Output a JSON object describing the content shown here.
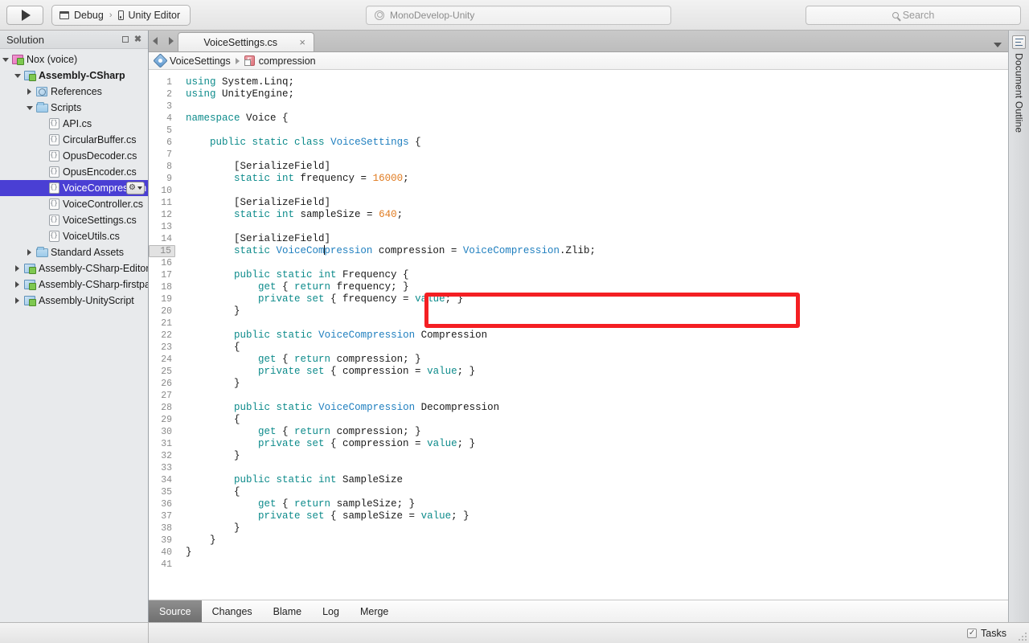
{
  "toolbar": {
    "run_button": "run-button",
    "configuration": "Debug",
    "target": "Unity Editor",
    "separator": "›",
    "status_text": "MonoDevelop-Unity",
    "search_placeholder": "Search"
  },
  "sidebar": {
    "title": "Solution",
    "header_buttons": [
      "minimize",
      "close"
    ],
    "tree": [
      {
        "label": "Nox (voice)",
        "indent": 0,
        "twisty": "down",
        "icon": "solution-icon",
        "bold": false,
        "selected": false
      },
      {
        "label": "Assembly-CSharp",
        "indent": 1,
        "twisty": "down",
        "icon": "project-icon",
        "bold": true,
        "selected": false
      },
      {
        "label": "References",
        "indent": 2,
        "twisty": "right",
        "icon": "references-icon",
        "bold": false,
        "selected": false
      },
      {
        "label": "Scripts",
        "indent": 2,
        "twisty": "down",
        "icon": "folder-icon",
        "bold": false,
        "selected": false
      },
      {
        "label": "API.cs",
        "indent": 3,
        "twisty": "none",
        "icon": "csharp-file-icon",
        "bold": false,
        "selected": false
      },
      {
        "label": "CircularBuffer.cs",
        "indent": 3,
        "twisty": "none",
        "icon": "csharp-file-icon",
        "bold": false,
        "selected": false
      },
      {
        "label": "OpusDecoder.cs",
        "indent": 3,
        "twisty": "none",
        "icon": "csharp-file-icon",
        "bold": false,
        "selected": false
      },
      {
        "label": "OpusEncoder.cs",
        "indent": 3,
        "twisty": "none",
        "icon": "csharp-file-icon",
        "bold": false,
        "selected": false
      },
      {
        "label": "VoiceCompression",
        "indent": 3,
        "twisty": "none",
        "icon": "csharp-file-icon",
        "bold": false,
        "selected": true
      },
      {
        "label": "VoiceController.cs",
        "indent": 3,
        "twisty": "none",
        "icon": "csharp-file-icon",
        "bold": false,
        "selected": false
      },
      {
        "label": "VoiceSettings.cs",
        "indent": 3,
        "twisty": "none",
        "icon": "csharp-file-icon",
        "bold": false,
        "selected": false
      },
      {
        "label": "VoiceUtils.cs",
        "indent": 3,
        "twisty": "none",
        "icon": "csharp-file-icon",
        "bold": false,
        "selected": false
      },
      {
        "label": "Standard Assets",
        "indent": 2,
        "twisty": "right",
        "icon": "folder-icon",
        "bold": false,
        "selected": false
      },
      {
        "label": "Assembly-CSharp-Editor",
        "indent": 1,
        "twisty": "right",
        "icon": "project-icon",
        "bold": false,
        "selected": false
      },
      {
        "label": "Assembly-CSharp-firstpass",
        "indent": 1,
        "twisty": "right",
        "icon": "project-icon",
        "bold": false,
        "selected": false
      },
      {
        "label": "Assembly-UnityScript",
        "indent": 1,
        "twisty": "right",
        "icon": "project-icon",
        "bold": false,
        "selected": false
      }
    ]
  },
  "editor": {
    "tab": {
      "title": "VoiceSettings.cs",
      "close": "×"
    },
    "breadcrumb": {
      "class": "VoiceSettings",
      "member": "compression",
      "separator": "▶"
    },
    "current_line": 15,
    "total_lines": 41,
    "lines": [
      {
        "n": 1,
        "tokens": [
          {
            "t": "kw",
            "s": "using"
          },
          {
            "t": "pl",
            "s": " System.Linq;"
          }
        ]
      },
      {
        "n": 2,
        "tokens": [
          {
            "t": "kw",
            "s": "using"
          },
          {
            "t": "pl",
            "s": " UnityEngine;"
          }
        ]
      },
      {
        "n": 3,
        "tokens": []
      },
      {
        "n": 4,
        "tokens": [
          {
            "t": "kw",
            "s": "namespace"
          },
          {
            "t": "pl",
            "s": " Voice {"
          }
        ]
      },
      {
        "n": 5,
        "tokens": []
      },
      {
        "n": 6,
        "tokens": [
          {
            "t": "pl",
            "s": "    "
          },
          {
            "t": "kw",
            "s": "public static class"
          },
          {
            "t": "pl",
            "s": " "
          },
          {
            "t": "ty",
            "s": "VoiceSettings"
          },
          {
            "t": "pl",
            "s": " {"
          }
        ]
      },
      {
        "n": 7,
        "tokens": []
      },
      {
        "n": 8,
        "tokens": [
          {
            "t": "pl",
            "s": "        [SerializeField]"
          }
        ]
      },
      {
        "n": 9,
        "tokens": [
          {
            "t": "pl",
            "s": "        "
          },
          {
            "t": "kw",
            "s": "static int"
          },
          {
            "t": "pl",
            "s": " frequency = "
          },
          {
            "t": "num",
            "s": "16000"
          },
          {
            "t": "pl",
            "s": ";"
          }
        ]
      },
      {
        "n": 10,
        "tokens": []
      },
      {
        "n": 11,
        "tokens": [
          {
            "t": "pl",
            "s": "        [SerializeField]"
          }
        ]
      },
      {
        "n": 12,
        "tokens": [
          {
            "t": "pl",
            "s": "        "
          },
          {
            "t": "kw",
            "s": "static int"
          },
          {
            "t": "pl",
            "s": " sampleSize = "
          },
          {
            "t": "num",
            "s": "640"
          },
          {
            "t": "pl",
            "s": ";"
          }
        ]
      },
      {
        "n": 13,
        "tokens": []
      },
      {
        "n": 14,
        "tokens": [
          {
            "t": "pl",
            "s": "        [SerializeField]"
          }
        ]
      },
      {
        "n": 15,
        "tokens": [
          {
            "t": "pl",
            "s": "        "
          },
          {
            "t": "kw",
            "s": "static"
          },
          {
            "t": "pl",
            "s": " "
          },
          {
            "t": "ty",
            "s": "VoiceCom"
          },
          {
            "t": "caret",
            "s": ""
          },
          {
            "t": "ty",
            "s": "pression"
          },
          {
            "t": "pl",
            "s": " compression = "
          },
          {
            "t": "ty",
            "s": "VoiceCompression"
          },
          {
            "t": "pl",
            "s": ".Zlib;"
          }
        ]
      },
      {
        "n": 16,
        "tokens": []
      },
      {
        "n": 17,
        "tokens": [
          {
            "t": "pl",
            "s": "        "
          },
          {
            "t": "kw",
            "s": "public static int"
          },
          {
            "t": "pl",
            "s": " Frequency {"
          }
        ]
      },
      {
        "n": 18,
        "tokens": [
          {
            "t": "pl",
            "s": "            "
          },
          {
            "t": "kw",
            "s": "get"
          },
          {
            "t": "pl",
            "s": " { "
          },
          {
            "t": "kw",
            "s": "return"
          },
          {
            "t": "pl",
            "s": " frequency; }"
          }
        ]
      },
      {
        "n": 19,
        "tokens": [
          {
            "t": "pl",
            "s": "            "
          },
          {
            "t": "kw",
            "s": "private set"
          },
          {
            "t": "pl",
            "s": " { frequency = "
          },
          {
            "t": "kw",
            "s": "value"
          },
          {
            "t": "pl",
            "s": "; }"
          }
        ]
      },
      {
        "n": 20,
        "tokens": [
          {
            "t": "pl",
            "s": "        }"
          }
        ]
      },
      {
        "n": 21,
        "tokens": []
      },
      {
        "n": 22,
        "tokens": [
          {
            "t": "pl",
            "s": "        "
          },
          {
            "t": "kw",
            "s": "public static"
          },
          {
            "t": "pl",
            "s": " "
          },
          {
            "t": "ty",
            "s": "VoiceCompression"
          },
          {
            "t": "pl",
            "s": " Compression"
          }
        ]
      },
      {
        "n": 23,
        "tokens": [
          {
            "t": "pl",
            "s": "        {"
          }
        ]
      },
      {
        "n": 24,
        "tokens": [
          {
            "t": "pl",
            "s": "            "
          },
          {
            "t": "kw",
            "s": "get"
          },
          {
            "t": "pl",
            "s": " { "
          },
          {
            "t": "kw",
            "s": "return"
          },
          {
            "t": "pl",
            "s": " compression; }"
          }
        ]
      },
      {
        "n": 25,
        "tokens": [
          {
            "t": "pl",
            "s": "            "
          },
          {
            "t": "kw",
            "s": "private set"
          },
          {
            "t": "pl",
            "s": " { compression = "
          },
          {
            "t": "kw",
            "s": "value"
          },
          {
            "t": "pl",
            "s": "; }"
          }
        ]
      },
      {
        "n": 26,
        "tokens": [
          {
            "t": "pl",
            "s": "        }"
          }
        ]
      },
      {
        "n": 27,
        "tokens": []
      },
      {
        "n": 28,
        "tokens": [
          {
            "t": "pl",
            "s": "        "
          },
          {
            "t": "kw",
            "s": "public static"
          },
          {
            "t": "pl",
            "s": " "
          },
          {
            "t": "ty",
            "s": "VoiceCompression"
          },
          {
            "t": "pl",
            "s": " Decompression"
          }
        ]
      },
      {
        "n": 29,
        "tokens": [
          {
            "t": "pl",
            "s": "        {"
          }
        ]
      },
      {
        "n": 30,
        "tokens": [
          {
            "t": "pl",
            "s": "            "
          },
          {
            "t": "kw",
            "s": "get"
          },
          {
            "t": "pl",
            "s": " { "
          },
          {
            "t": "kw",
            "s": "return"
          },
          {
            "t": "pl",
            "s": " compression; }"
          }
        ]
      },
      {
        "n": 31,
        "tokens": [
          {
            "t": "pl",
            "s": "            "
          },
          {
            "t": "kw",
            "s": "private set"
          },
          {
            "t": "pl",
            "s": " { compression = "
          },
          {
            "t": "kw",
            "s": "value"
          },
          {
            "t": "pl",
            "s": "; }"
          }
        ]
      },
      {
        "n": 32,
        "tokens": [
          {
            "t": "pl",
            "s": "        }"
          }
        ]
      },
      {
        "n": 33,
        "tokens": []
      },
      {
        "n": 34,
        "tokens": [
          {
            "t": "pl",
            "s": "        "
          },
          {
            "t": "kw",
            "s": "public static int"
          },
          {
            "t": "pl",
            "s": " SampleSize"
          }
        ]
      },
      {
        "n": 35,
        "tokens": [
          {
            "t": "pl",
            "s": "        {"
          }
        ]
      },
      {
        "n": 36,
        "tokens": [
          {
            "t": "pl",
            "s": "            "
          },
          {
            "t": "kw",
            "s": "get"
          },
          {
            "t": "pl",
            "s": " { "
          },
          {
            "t": "kw",
            "s": "return"
          },
          {
            "t": "pl",
            "s": " sampleSize; }"
          }
        ]
      },
      {
        "n": 37,
        "tokens": [
          {
            "t": "pl",
            "s": "            "
          },
          {
            "t": "kw",
            "s": "private set"
          },
          {
            "t": "pl",
            "s": " { sampleSize = "
          },
          {
            "t": "kw",
            "s": "value"
          },
          {
            "t": "pl",
            "s": "; }"
          }
        ]
      },
      {
        "n": 38,
        "tokens": [
          {
            "t": "pl",
            "s": "        }"
          }
        ]
      },
      {
        "n": 39,
        "tokens": [
          {
            "t": "pl",
            "s": "    }"
          }
        ]
      },
      {
        "n": 40,
        "tokens": [
          {
            "t": "pl",
            "s": "}"
          }
        ]
      },
      {
        "n": 41,
        "tokens": []
      }
    ],
    "annotation": {
      "shape": "rectangle",
      "color": "#f41f23",
      "covers_lines": [
        14,
        15
      ]
    }
  },
  "view_tabs": [
    {
      "label": "Source",
      "active": true
    },
    {
      "label": "Changes",
      "active": false
    },
    {
      "label": "Blame",
      "active": false
    },
    {
      "label": "Log",
      "active": false
    },
    {
      "label": "Merge",
      "active": false
    }
  ],
  "right_dock": {
    "label": "Document Outline"
  },
  "status_bar": {
    "tasks_label": "Tasks",
    "tasks_checked": true
  }
}
